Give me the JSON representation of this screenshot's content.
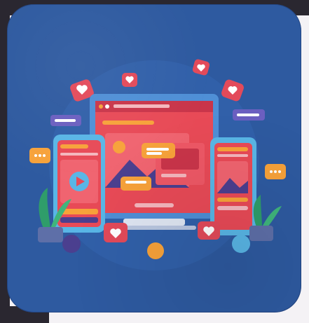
{
  "illustration": {
    "subject": "social-media-devices",
    "icons": [
      "heart-icon",
      "play-icon",
      "chat-bubble-icon",
      "image-icon"
    ],
    "colors": {
      "background": "#2e5aa0",
      "screen_red": "#e84a57",
      "accent_orange": "#f7a23a",
      "accent_blue": "#59b6e6",
      "accent_purple": "#4b3f8f",
      "plant_green": "#2f9d6a",
      "heart_bubble": "#e34a5a"
    }
  }
}
